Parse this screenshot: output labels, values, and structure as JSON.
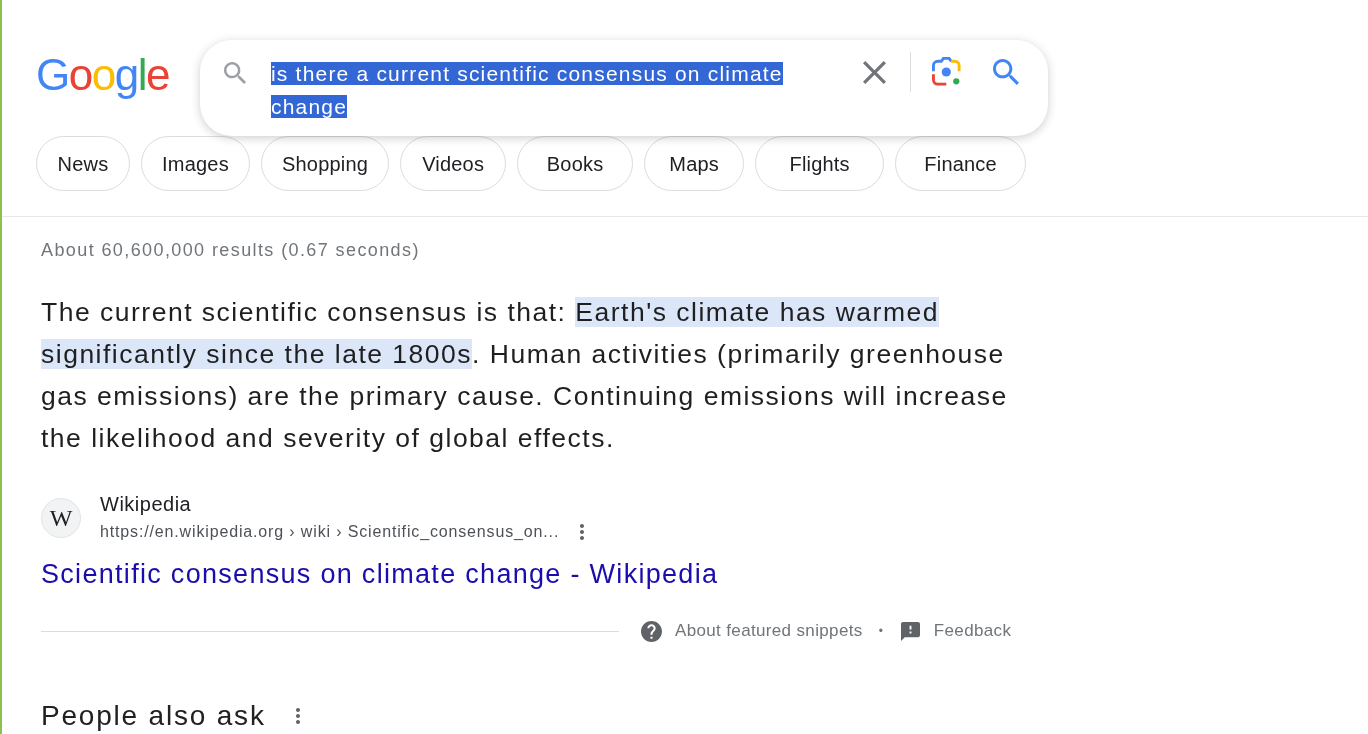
{
  "logo": {
    "text": "Google"
  },
  "search": {
    "query": "is there a current scientific consensus on climate change",
    "query_selected": true
  },
  "filters": [
    {
      "label": "News"
    },
    {
      "label": "Images"
    },
    {
      "label": "Shopping"
    },
    {
      "label": "Videos"
    },
    {
      "label": "Books"
    },
    {
      "label": "Maps"
    },
    {
      "label": "Flights"
    },
    {
      "label": "Finance"
    }
  ],
  "results_stats": "About 60,600,000 results (0.67 seconds)",
  "featured_snippet": {
    "answer": [
      {
        "text": "The current scientific consensus is that: ",
        "highlighted": false
      },
      {
        "text": "Earth's climate has warmed significantly since the late 1800s",
        "highlighted": true
      },
      {
        "text": ". Human activities (primarily greenhouse gas emissions) are the primary cause. Continuing emissions will increase the likelihood and severity of global effects.",
        "highlighted": false
      }
    ],
    "source": {
      "favicon": "W",
      "site_name": "Wikipedia",
      "url": "https://en.wikipedia.org › wiki › Scientific_consensus_on...",
      "title": "Scientific consensus on climate change - Wikipedia"
    },
    "footer": {
      "about": "About featured snippets",
      "separator": "•",
      "feedback": "Feedback"
    }
  },
  "people_also_ask": {
    "heading": "People also ask"
  }
}
